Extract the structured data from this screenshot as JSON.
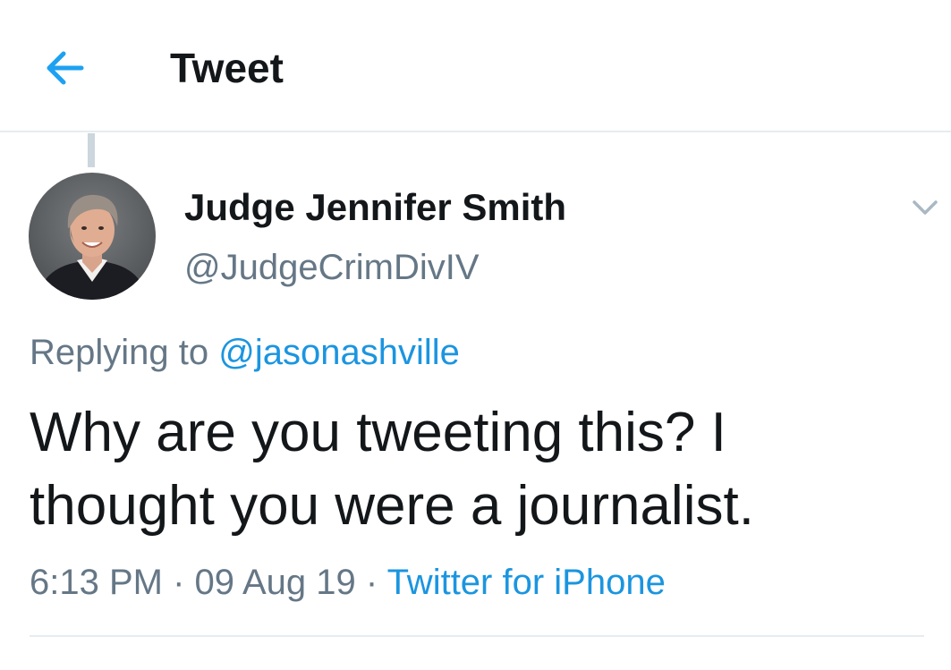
{
  "header": {
    "back_icon": "arrow-left-icon",
    "title": "Tweet",
    "accent_color": "#1da1f2"
  },
  "tweet": {
    "author_name": "Judge Jennifer Smith",
    "author_handle": "@JudgeCrimDivIV",
    "caret_icon": "chevron-down-icon",
    "replying_label": "Replying to",
    "replying_to": "@jasonashville",
    "text": "Why are you tweeting this? I thought you were a journalist.",
    "time": "6:13 PM",
    "separator": "·",
    "date": "09 Aug 19",
    "source": "Twitter for iPhone"
  },
  "colors": {
    "text_primary": "#14171a",
    "text_secondary": "#657786",
    "link": "#1b95e0",
    "divider": "#e6ecf0"
  }
}
